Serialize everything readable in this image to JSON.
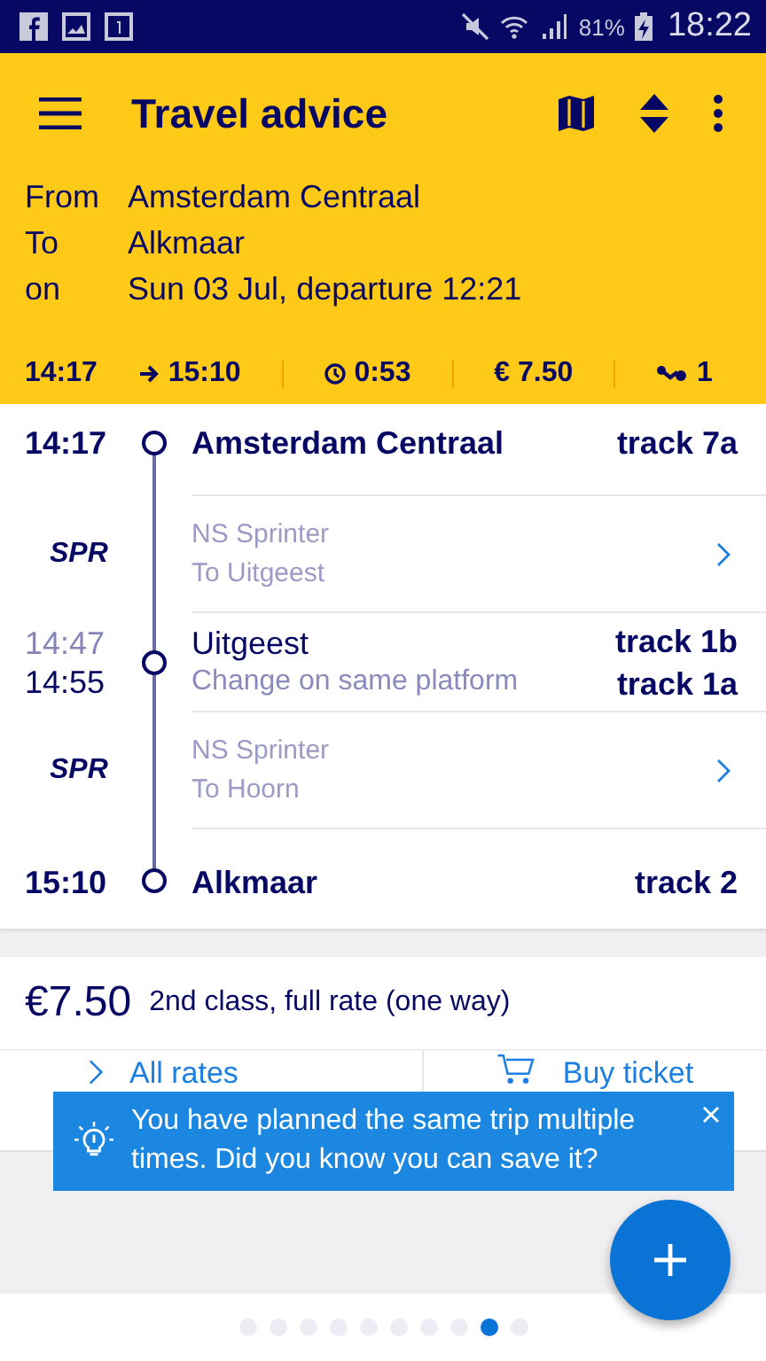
{
  "status_bar": {
    "battery": "81%",
    "time": "18:22"
  },
  "toolbar": {
    "title": "Travel advice"
  },
  "query": [
    {
      "label": "From",
      "value": "Amsterdam Centraal"
    },
    {
      "label": "To",
      "value": "Alkmaar"
    },
    {
      "label": "on",
      "value": "Sun 03 Jul, departure 12:21"
    }
  ],
  "summary": {
    "departure": "14:17",
    "arrival": "15:10",
    "duration": "0:53",
    "price": "€ 7.50",
    "transfers": "1"
  },
  "journey": [
    {
      "kind": "stop",
      "times": [
        "14:17"
      ],
      "name": "Amsterdam Centraal",
      "tracks": [
        "track 7a"
      ]
    },
    {
      "kind": "leg",
      "mode": "SPR",
      "operator": "NS Sprinter",
      "direction": "To Uitgeest"
    },
    {
      "kind": "stop",
      "times": [
        "14:47",
        "14:55"
      ],
      "name": "Uitgeest",
      "note": "Change on same platform",
      "tracks": [
        "track 1b",
        "track 1a"
      ]
    },
    {
      "kind": "leg",
      "mode": "SPR",
      "operator": "NS Sprinter",
      "direction": "To Hoorn"
    },
    {
      "kind": "stop",
      "times": [
        "15:10"
      ],
      "name": "Alkmaar",
      "tracks": [
        "track 2"
      ]
    }
  ],
  "fare": {
    "price": "€7.50",
    "description": "2nd class, full rate (one way)"
  },
  "actions": [
    "All rates",
    "Buy ticket"
  ],
  "tip": {
    "text": "You have planned the same trip multiple times. Did you know you can save it?"
  },
  "pager": [
    {
      "selected": false
    },
    {
      "selected": false
    },
    {
      "selected": false
    },
    {
      "selected": false
    },
    {
      "selected": false
    },
    {
      "selected": false
    },
    {
      "selected": false
    },
    {
      "selected": false
    },
    {
      "selected": true
    },
    {
      "selected": false
    }
  ]
}
